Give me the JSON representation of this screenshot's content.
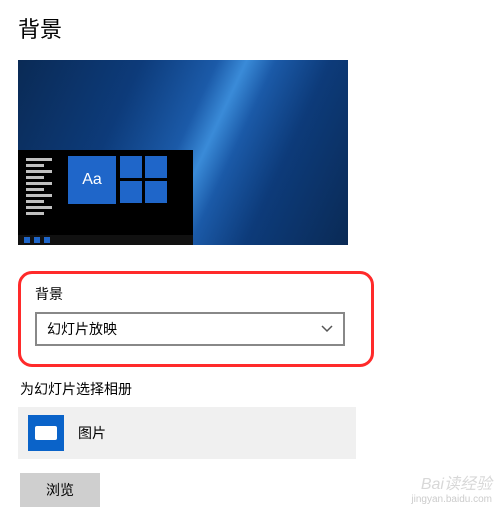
{
  "page": {
    "title": "背景"
  },
  "preview": {
    "aa_label": "Aa"
  },
  "background_setting": {
    "label": "背景",
    "selected": "幻灯片放映"
  },
  "album": {
    "label": "为幻灯片选择相册",
    "folder_name": "图片"
  },
  "buttons": {
    "browse": "浏览"
  },
  "watermark": {
    "brand": "Bai读经验",
    "url": "jingyan.baidu.com"
  },
  "colors": {
    "accent": "#0a63c9",
    "highlight": "#ff2a2a"
  }
}
